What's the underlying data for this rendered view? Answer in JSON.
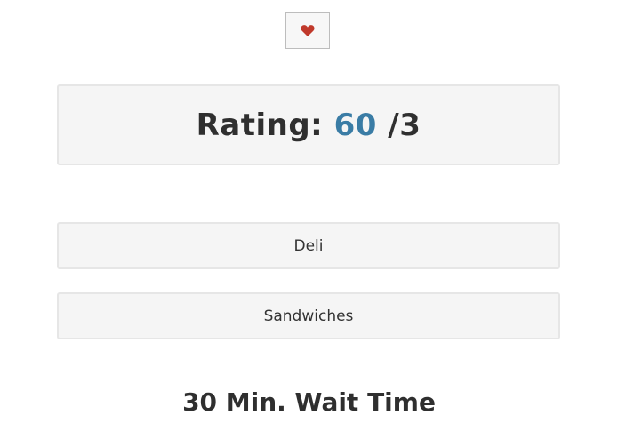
{
  "favorite": {
    "icon": "heart-icon",
    "color": "#c0392b"
  },
  "rating": {
    "label": "Rating:",
    "value": "60",
    "max": "/3",
    "value_color": "#3a7ca5"
  },
  "tags": [
    {
      "label": "Deli"
    },
    {
      "label": "Sandwiches"
    }
  ],
  "wait_time": "30 Min. Wait Time"
}
